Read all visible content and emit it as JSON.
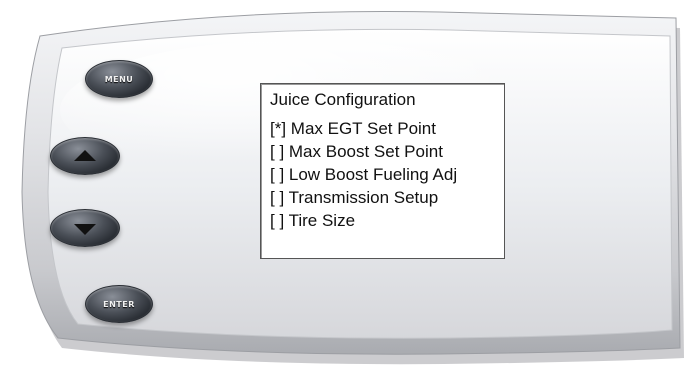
{
  "device": {
    "buttons": {
      "menu_label": "MENU",
      "enter_label": "ENTER",
      "up_icon": "triangle-up-icon",
      "down_icon": "triangle-down-icon"
    },
    "colors": {
      "body": "#d9dadd",
      "button": "#3a3e45",
      "screen": "#ffffff"
    }
  },
  "screen": {
    "title": "Juice Configuration",
    "items": [
      {
        "label": "[*] Max EGT Set Point"
      },
      {
        "label": "[ ] Max Boost Set Point"
      },
      {
        "label": "[ ] Low Boost Fueling Adj"
      },
      {
        "label": "[ ] Transmission Setup"
      },
      {
        "label": "[ ] Tire Size"
      }
    ]
  }
}
